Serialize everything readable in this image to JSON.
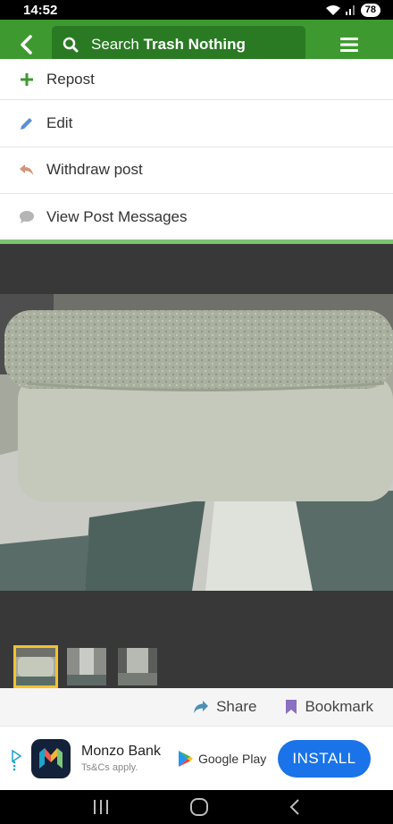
{
  "status_bar": {
    "time": "14:52",
    "battery": "78"
  },
  "app_bar": {
    "search_prefix": "Search ",
    "search_brand": "Trash Nothing",
    "color": "#3e9a30"
  },
  "menu": {
    "items": [
      {
        "label": "Repost",
        "icon": "plus-icon"
      },
      {
        "label": "Edit",
        "icon": "pencil-icon"
      },
      {
        "label": "Withdraw post",
        "icon": "undo-arrow-icon"
      },
      {
        "label": "View Post Messages",
        "icon": "speech-bubble-icon"
      }
    ]
  },
  "gallery": {
    "thumbnail_count": 3,
    "selected_index": 0
  },
  "actions": {
    "share": "Share",
    "bookmark": "Bookmark"
  },
  "ad": {
    "title": "Monzo Bank",
    "subtitle": "Ts&Cs apply.",
    "store": "Google Play",
    "install": "INSTALL"
  }
}
